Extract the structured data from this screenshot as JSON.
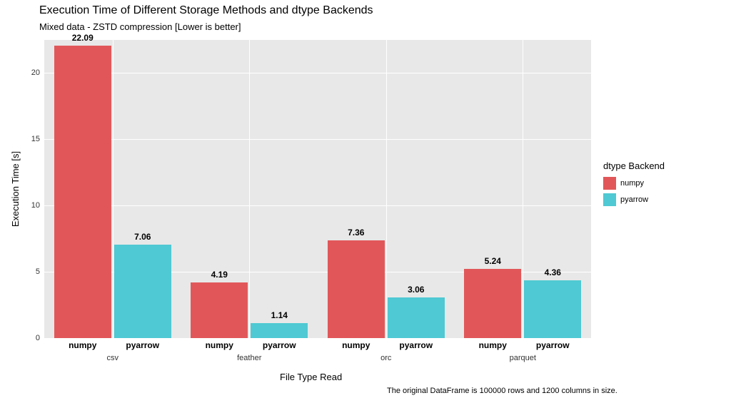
{
  "chart_data": {
    "type": "bar",
    "title": "Execution Time of Different Storage Methods and dtype Backends",
    "subtitle": "Mixed data - ZSTD compression [Lower is better]",
    "xlabel": "File Type Read",
    "ylabel": "Execution Time [s]",
    "caption": "The original DataFrame is 100000 rows and 1200 columns in size.",
    "categories": [
      "csv",
      "feather",
      "orc",
      "parquet"
    ],
    "series": [
      {
        "name": "numpy",
        "values": [
          22.09,
          4.19,
          7.36,
          5.24
        ],
        "color": "#e15759"
      },
      {
        "name": "pyarrow",
        "values": [
          7.06,
          1.14,
          3.06,
          4.36
        ],
        "color": "#4fc9d3"
      }
    ],
    "ylim": [
      0,
      22.5
    ],
    "yticks": [
      0,
      5,
      10,
      15,
      20
    ],
    "legend_title": "dtype Backend",
    "legend_items": [
      "numpy",
      "pyarrow"
    ],
    "dodge_labels": [
      "numpy",
      "pyarrow"
    ],
    "value_labels": [
      [
        "22.09",
        "4.19",
        "7.36",
        "5.24"
      ],
      [
        "7.06",
        "1.14",
        "3.06",
        "4.36"
      ]
    ]
  }
}
